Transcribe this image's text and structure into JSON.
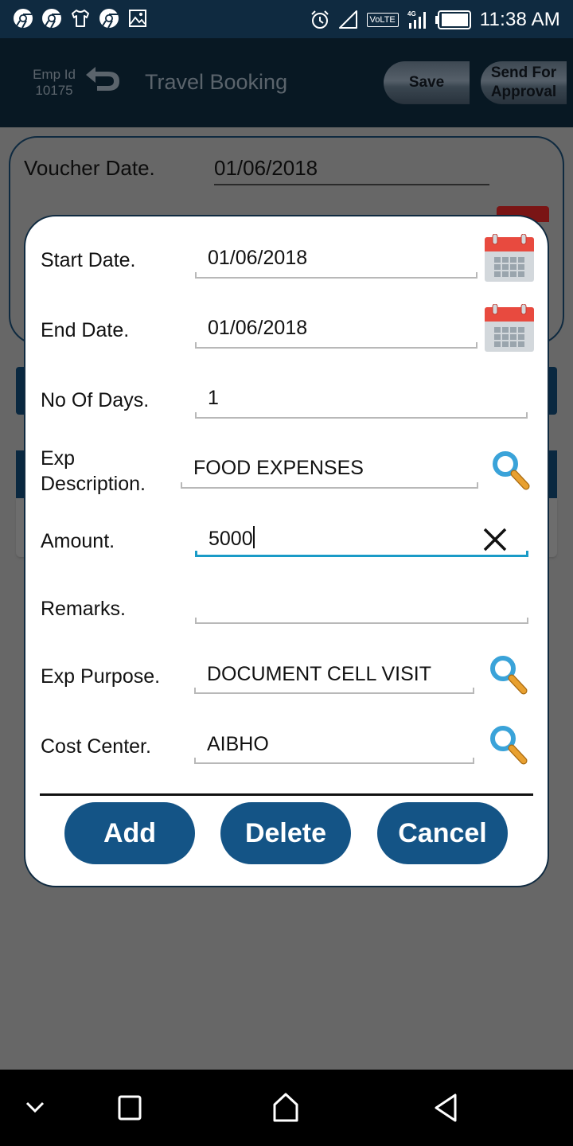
{
  "status_bar": {
    "time": "11:38 AM",
    "network": "4G",
    "volte": "VoLTE",
    "left_icons": [
      "chrome-icon",
      "chrome-icon",
      "tshirt-icon",
      "chrome-icon",
      "image-icon"
    ],
    "right_icons": [
      "alarm-icon",
      "signal-icon",
      "volte-icon",
      "4g-signal-icon",
      "battery-icon"
    ]
  },
  "toolbar": {
    "emp_id_label": "Emp Id",
    "emp_id_value": "10175",
    "title": "Travel Booking",
    "save_label": "Save",
    "send_line1": "Send For",
    "send_line2": "Approval"
  },
  "background_form": {
    "voucher_date_label": "Voucher Date.",
    "voucher_date_value": "01/06/2018"
  },
  "dialog": {
    "start_date_label": "Start Date.",
    "start_date_value": "01/06/2018",
    "end_date_label": "End Date.",
    "end_date_value": "01/06/2018",
    "no_of_days_label": "No Of Days.",
    "no_of_days_value": "1",
    "exp_desc_label_line1": "Exp",
    "exp_desc_label_line2": "Description.",
    "exp_desc_value": "FOOD EXPENSES",
    "amount_label": "Amount.",
    "amount_value": "5000",
    "remarks_label": "Remarks.",
    "remarks_value": "",
    "exp_purpose_label": "Exp Purpose.",
    "exp_purpose_value": "DOCUMENT CELL VISIT",
    "cost_center_label": "Cost Center.",
    "cost_center_value": "AIBHO",
    "buttons": {
      "add": "Add",
      "delete": "Delete",
      "cancel": "Cancel"
    }
  },
  "colors": {
    "primary_button": "#145486",
    "app_bar": "#0f2a40",
    "active_underline": "#1a9bc7",
    "calendar_red": "#e84a3f",
    "search_blue": "#3aa3d9",
    "search_handle": "#e8a030"
  },
  "nav_bar": {
    "icons": [
      "chevron-down-icon",
      "recents-icon",
      "home-icon",
      "back-icon"
    ]
  }
}
